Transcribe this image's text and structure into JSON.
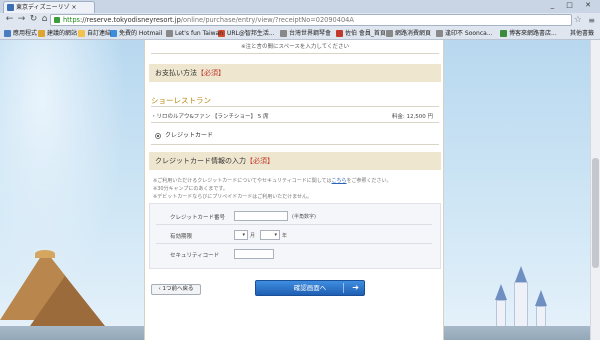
{
  "browser": {
    "tab_title": "東京ディズニーリゾ ×",
    "url_https": "https",
    "url_host": "://reserve.tokyodisneyresort.jp",
    "url_path": "/online/purchase/entry/view/?receiptNo=02090404A",
    "bookmarks": [
      {
        "label": "應用程式",
        "color": "#4a7cc4"
      },
      {
        "label": "建議的網站",
        "color": "#e0a530"
      },
      {
        "label": "自訂連結",
        "color": "#f2c14e"
      },
      {
        "label": "免費的 Hotmail",
        "color": "#3c8dde"
      },
      {
        "label": "Let's fun Taiwan",
        "color": "#888888"
      },
      {
        "label": "URL@智邦生活...",
        "color": "#d24a2f"
      },
      {
        "label": "台灣世界鋼琴會",
        "color": "#888888"
      },
      {
        "label": "佐伯 會員_首頁",
        "color": "#c0392b"
      },
      {
        "label": "網路消費網頁",
        "color": "#888888"
      },
      {
        "label": "逢印不 Soonca...",
        "color": "#888888"
      },
      {
        "label": "博客來網路書店...",
        "color": "#3a8c3a"
      }
    ],
    "other_bookmarks": "其他書籤"
  },
  "page": {
    "top_note": "※注と言の間にスペースを入力してください",
    "payment_header": "お支払い方法",
    "required": "【必須】",
    "restaurant_name": "ショーレストラン",
    "item_text": "・リロのルアウ&ファン 【ランチショー】  5 席",
    "item_amount_label": "料金:",
    "item_amount": "12,500",
    "currency": "円",
    "payment_option": "クレジットカード",
    "cc_header": "クレジットカード情報の入力",
    "cc_note_1a": "※ご利用いただけるクレジットカードについてやセキュリティコードに関しては",
    "cc_note_1_link": "こちら",
    "cc_note_1b": "をご参照ください。",
    "cc_note_2": "※30分キャンプにのあくまです。",
    "cc_note_3": "※デビットカードならびにプリペイドカードはご利用いただけません。",
    "card_number_label": "クレジットカード番号",
    "card_number_suffix": "(半角数字)",
    "expiry_label": "有効期限",
    "expiry_month_suffix": "月",
    "expiry_year_suffix": "年",
    "security_label": "セキュリティコード",
    "back_button": "1つ前へ戻る",
    "confirm_button": "確認画面へ"
  }
}
